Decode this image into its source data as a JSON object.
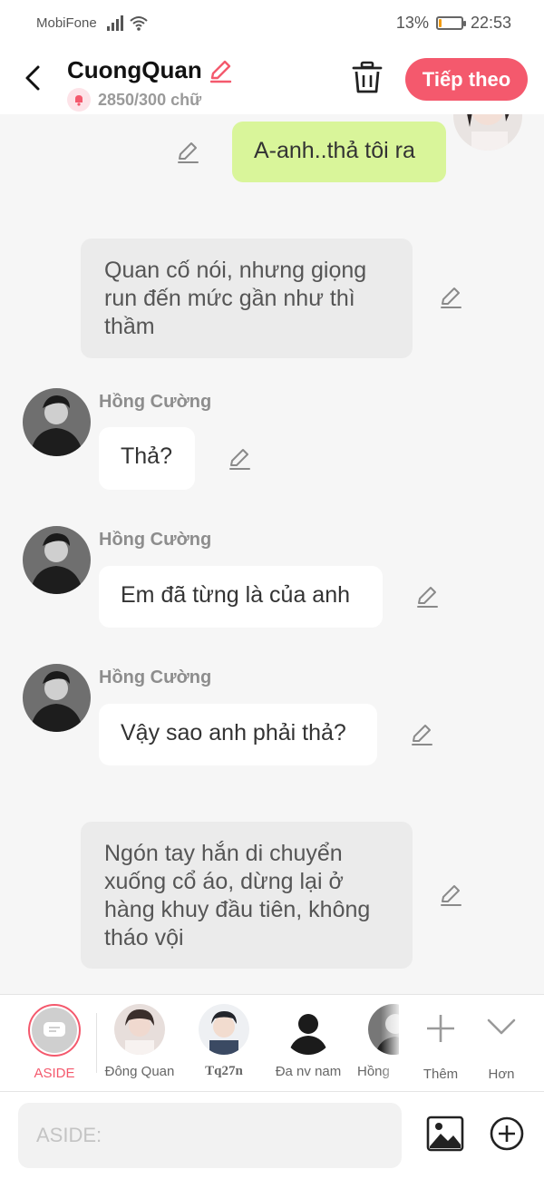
{
  "status_bar": {
    "carrier": "MobiFone",
    "battery": "13%",
    "battery_level": 0.13,
    "time": "22:53"
  },
  "header": {
    "title": "CuongQuan",
    "word_count": "2850/300 chữ",
    "next_label": "Tiếp theo"
  },
  "messages": [
    {
      "type": "self",
      "text": "A-anh..thả tôi ra"
    },
    {
      "type": "narration",
      "text": "Quan cố nói, nhưng giọng run đến mức gần như thì thầm"
    },
    {
      "type": "other",
      "sender": "Hồng Cường",
      "text": "Thả?"
    },
    {
      "type": "other",
      "sender": "Hồng Cường",
      "text": "Em đã từng là của anh"
    },
    {
      "type": "other",
      "sender": "Hồng Cường",
      "text": "Vậy sao anh phải thả?"
    },
    {
      "type": "narration",
      "text": "Ngón tay hắn di chuyển xuống cổ áo, dừng lại ở hàng khuy đầu tiên, không tháo vội"
    }
  ],
  "characters": [
    {
      "label": "ASIDE"
    },
    {
      "label": "Đông Quan"
    },
    {
      "label": "Tq27n"
    },
    {
      "label": "Đa nv nam"
    },
    {
      "label": "Hồng"
    }
  ],
  "tools": {
    "more_label": "Thêm",
    "less_label": "Hơn"
  },
  "input": {
    "placeholder": "ASIDE:"
  },
  "colors": {
    "accent": "#f4596d",
    "self_bubble": "#d9f59a",
    "narration_bubble": "#ebebeb"
  }
}
